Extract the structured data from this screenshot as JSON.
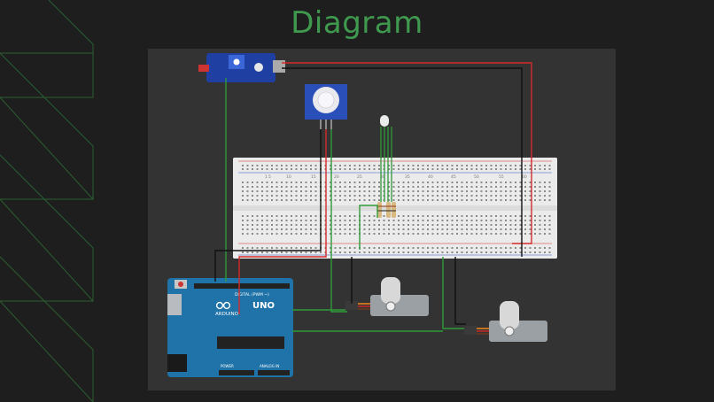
{
  "header": {
    "title": "Diagram"
  },
  "arduino": {
    "model": "UNO",
    "brand": "ARDUINO",
    "digital_label": "DIGITAL (PWM ~)",
    "power_label": "POWER",
    "analog_label": "ANALOG IN"
  },
  "breadboard": {
    "column_numbers": [
      "1",
      "5",
      "10",
      "15",
      "20",
      "25",
      "30",
      "35",
      "40",
      "45",
      "50",
      "55",
      "60"
    ]
  },
  "colors": {
    "accent": "#3f9a4f",
    "background": "#1e1e1e",
    "panel": "#333333",
    "wire_red": "#d42a2a",
    "wire_black": "#111111",
    "wire_green": "#2f9a3a"
  }
}
